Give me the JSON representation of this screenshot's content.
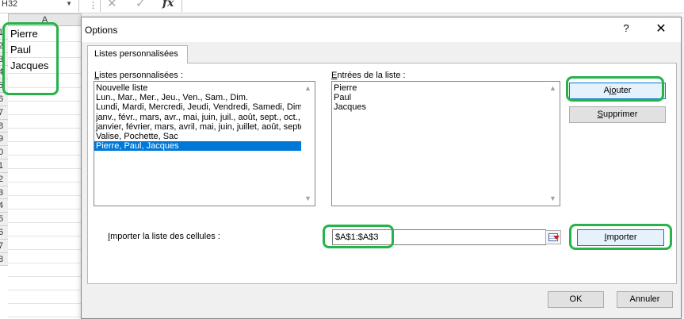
{
  "excel": {
    "name_box": "H32",
    "column_header": "A",
    "row_headers": [
      "1",
      "2",
      "3",
      "4",
      "5",
      "6",
      "7",
      "8",
      "9",
      "0",
      "1",
      "2",
      "3",
      "4",
      "5",
      "6",
      "7",
      "8"
    ],
    "cells": [
      "Pierre",
      "Paul",
      "Jacques"
    ],
    "fx_label": "fx"
  },
  "dialog": {
    "title": "Options",
    "help_label": "?",
    "close_label": "✕",
    "tab_label": "Listes personnalisées",
    "lists_label_prefix": "L",
    "lists_label_rest": "istes personnalisées :",
    "entries_label_prefix": "E",
    "entries_label_rest": "ntrées de la liste :",
    "custom_lists": [
      "Nouvelle liste",
      "Lun., Mar., Mer., Jeu., Ven., Sam., Dim.",
      "Lundi, Mardi, Mercredi, Jeudi, Vendredi, Samedi, Dimanche",
      "janv., févr., mars, avr., mai, juin, juil., août, sept., oct., nov., déc.",
      "janvier, février, mars, avril, mai, juin, juillet, août, septembre, octobre, novembre, décembre",
      "Valise, Pochette, Sac",
      "Pierre, Paul, Jacques"
    ],
    "selected_index": 6,
    "entries": [
      "Pierre",
      "Paul",
      "Jacques"
    ],
    "add_label_a": "Aj",
    "add_label_b": "o",
    "add_label_c": "uter",
    "delete_label_a": "S",
    "delete_label_b": "upprimer",
    "import_label_a": "I",
    "import_label_b": "mporter la liste des cellules :",
    "import_range": "$A$1:$A$3",
    "import_button_a": "I",
    "import_button_b": "mporter",
    "ok_label": "OK",
    "cancel_label": "Annuler"
  },
  "colors": {
    "highlight_green": "#25b34a",
    "selection_blue": "#0078d7"
  }
}
